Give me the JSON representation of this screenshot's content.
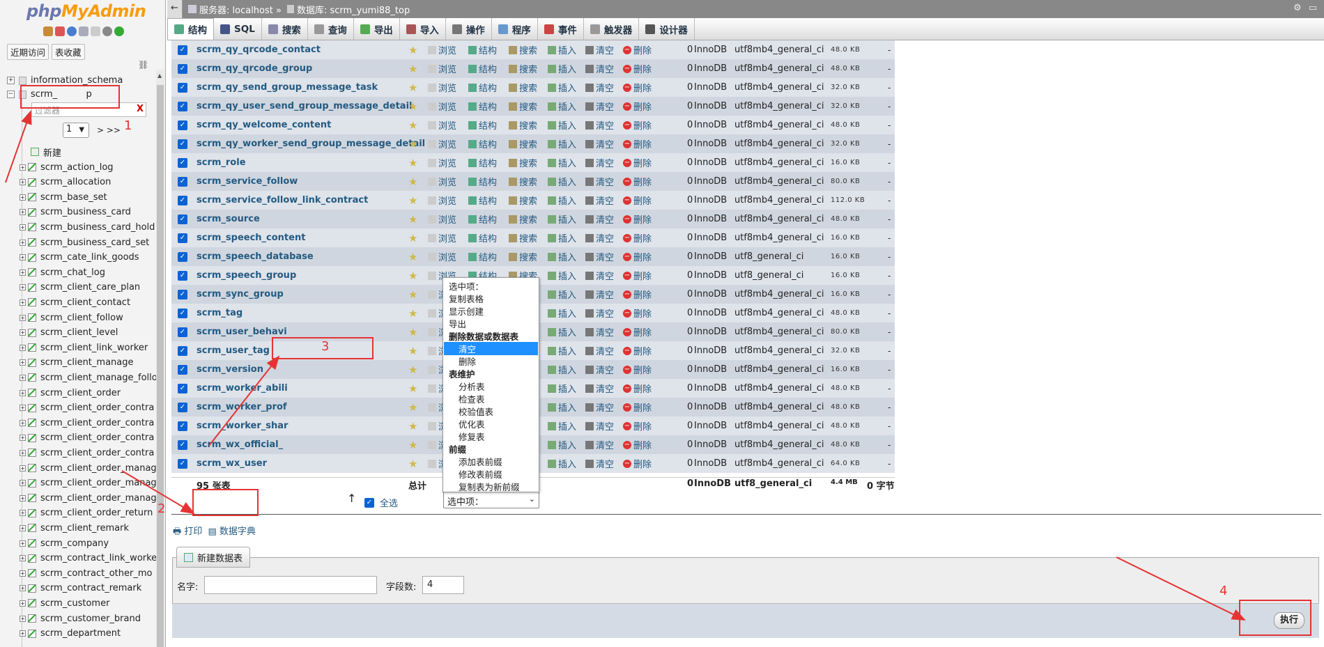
{
  "app": {
    "logo_php": "php",
    "logo_my": "MyAdmin"
  },
  "nav": {
    "recent": "近期访问",
    "favorites": "表收藏",
    "databases": [
      {
        "name": "information_schema"
      },
      {
        "name": "scrm_          p"
      }
    ],
    "filter_placeholder": "过滤器",
    "filter_clear": "X",
    "page": "1",
    "page_nav": "> >>",
    "new_label": "新建",
    "tables": [
      "scrm_action_log",
      "scrm_allocation",
      "scrm_base_set",
      "scrm_business_card",
      "scrm_business_card_hold",
      "scrm_business_card_set",
      "scrm_cate_link_goods",
      "scrm_chat_log",
      "scrm_client_care_plan",
      "scrm_client_contact",
      "scrm_client_follow",
      "scrm_client_level",
      "scrm_client_link_worker",
      "scrm_client_manage",
      "scrm_client_manage_follo",
      "scrm_client_order",
      "scrm_client_order_contra",
      "scrm_client_order_contra",
      "scrm_client_order_contra",
      "scrm_client_order_contra",
      "scrm_client_order_manag",
      "scrm_client_order_manag",
      "scrm_client_order_manag",
      "scrm_client_order_return",
      "scrm_client_remark",
      "scrm_company",
      "scrm_contract_link_worke",
      "scrm_contract_other_mo",
      "scrm_contract_remark",
      "scrm_customer",
      "scrm_customer_brand",
      "scrm_department"
    ]
  },
  "breadcrumb": {
    "server": "服务器: localhost »",
    "database": "数据库: scrm_yumi88_top"
  },
  "tabs": [
    "结构",
    "SQL",
    "搜索",
    "查询",
    "导出",
    "导入",
    "操作",
    "程序",
    "事件",
    "触发器",
    "设计器"
  ],
  "actions": {
    "browse": "浏览",
    "structure": "结构",
    "search": "搜索",
    "insert": "插入",
    "empty": "清空",
    "drop": "删除"
  },
  "table_rows": [
    {
      "name": "scrm_qy_qrcode_contact",
      "rows": "0",
      "engine": "InnoDB",
      "collation": "utf8mb4_general_ci",
      "size": "48.0 KB",
      "overhead": "-"
    },
    {
      "name": "scrm_qy_qrcode_group",
      "rows": "0",
      "engine": "InnoDB",
      "collation": "utf8mb4_general_ci",
      "size": "48.0 KB",
      "overhead": "-"
    },
    {
      "name": "scrm_qy_send_group_message_task",
      "rows": "0",
      "engine": "InnoDB",
      "collation": "utf8mb4_general_ci",
      "size": "32.0 KB",
      "overhead": "-"
    },
    {
      "name": "scrm_qy_user_send_group_message_detail",
      "rows": "0",
      "engine": "InnoDB",
      "collation": "utf8mb4_general_ci",
      "size": "32.0 KB",
      "overhead": "-"
    },
    {
      "name": "scrm_qy_welcome_content",
      "rows": "0",
      "engine": "InnoDB",
      "collation": "utf8mb4_general_ci",
      "size": "48.0 KB",
      "overhead": "-"
    },
    {
      "name": "scrm_qy_worker_send_group_message_detail",
      "rows": "0",
      "engine": "InnoDB",
      "collation": "utf8mb4_general_ci",
      "size": "32.0 KB",
      "overhead": "-"
    },
    {
      "name": "scrm_role",
      "rows": "0",
      "engine": "InnoDB",
      "collation": "utf8mb4_general_ci",
      "size": "16.0 KB",
      "overhead": "-"
    },
    {
      "name": "scrm_service_follow",
      "rows": "0",
      "engine": "InnoDB",
      "collation": "utf8mb4_general_ci",
      "size": "80.0 KB",
      "overhead": "-"
    },
    {
      "name": "scrm_service_follow_link_contract",
      "rows": "0",
      "engine": "InnoDB",
      "collation": "utf8mb4_general_ci",
      "size": "112.0 KB",
      "overhead": "-"
    },
    {
      "name": "scrm_source",
      "rows": "0",
      "engine": "InnoDB",
      "collation": "utf8mb4_general_ci",
      "size": "48.0 KB",
      "overhead": "-"
    },
    {
      "name": "scrm_speech_content",
      "rows": "0",
      "engine": "InnoDB",
      "collation": "utf8mb4_general_ci",
      "size": "16.0 KB",
      "overhead": "-"
    },
    {
      "name": "scrm_speech_database",
      "rows": "0",
      "engine": "InnoDB",
      "collation": "utf8_general_ci",
      "size": "16.0 KB",
      "overhead": "-"
    },
    {
      "name": "scrm_speech_group",
      "rows": "0",
      "engine": "InnoDB",
      "collation": "utf8_general_ci",
      "size": "16.0 KB",
      "overhead": "-"
    },
    {
      "name": "scrm_sync_group",
      "rows": "0",
      "engine": "InnoDB",
      "collation": "utf8mb4_general_ci",
      "size": "16.0 KB",
      "overhead": "-"
    },
    {
      "name": "scrm_tag",
      "rows": "0",
      "engine": "InnoDB",
      "collation": "utf8mb4_general_ci",
      "size": "48.0 KB",
      "overhead": "-"
    },
    {
      "name": "scrm_user_behavi",
      "rows": "0",
      "engine": "InnoDB",
      "collation": "utf8mb4_general_ci",
      "size": "80.0 KB",
      "overhead": "-"
    },
    {
      "name": "scrm_user_tag",
      "rows": "0",
      "engine": "InnoDB",
      "collation": "utf8mb4_general_ci",
      "size": "32.0 KB",
      "overhead": "-"
    },
    {
      "name": "scrm_version",
      "rows": "0",
      "engine": "InnoDB",
      "collation": "utf8mb4_general_ci",
      "size": "16.0 KB",
      "overhead": "-"
    },
    {
      "name": "scrm_worker_abili",
      "rows": "0",
      "engine": "InnoDB",
      "collation": "utf8mb4_general_ci",
      "size": "48.0 KB",
      "overhead": "-"
    },
    {
      "name": "scrm_worker_prof",
      "rows": "0",
      "engine": "InnoDB",
      "collation": "utf8mb4_general_ci",
      "size": "48.0 KB",
      "overhead": "-"
    },
    {
      "name": "scrm_worker_shar",
      "rows": "0",
      "engine": "InnoDB",
      "collation": "utf8mb4_general_ci",
      "size": "48.0 KB",
      "overhead": "-"
    },
    {
      "name": "scrm_wx_official_",
      "rows": "0",
      "engine": "InnoDB",
      "collation": "utf8mb4_general_ci",
      "size": "48.0 KB",
      "overhead": "-"
    },
    {
      "name": "scrm_wx_user",
      "rows": "0",
      "engine": "InnoDB",
      "collation": "utf8mb4_general_ci",
      "size": "64.0 KB",
      "overhead": "-"
    }
  ],
  "total": {
    "count": "95 张表",
    "label": "总计",
    "rows": "0",
    "engine": "InnoDB",
    "collation": "utf8_general_ci",
    "size": "4.4 MB",
    "overhead": "0 字节"
  },
  "menu": {
    "header": "选中项：",
    "copy": "复制表格",
    "show_create": "显示创建",
    "export": "导出",
    "sec_delete": "删除数据或数据表",
    "empty": "清空",
    "drop": "删除",
    "sec_maint": "表维护",
    "analyze": "分析表",
    "check": "检查表",
    "checksum": "校验值表",
    "optimize": "优化表",
    "repair": "修复表",
    "sec_prefix": "前缀",
    "add_prefix": "添加表前缀",
    "replace_prefix": "修改表前缀",
    "copy_prefix": "复制表为新前缀"
  },
  "bulk": {
    "select_all": "全选",
    "select_value": "选中项："
  },
  "footer": {
    "print": "打印",
    "dictionary": "数据字典",
    "new_table": "新建数据表",
    "name_label": "名字:",
    "name_value": "",
    "fields_label": "字段数:",
    "fields_value": "4",
    "go": "执行"
  },
  "annotations": {
    "n1": "1",
    "n2": "2",
    "n3": "3",
    "n4": "4"
  },
  "colors": {
    "accent": "#235a81",
    "highlight": "#1e90ff",
    "annotation": "#e53333",
    "checkbox": "#0a63d6"
  }
}
